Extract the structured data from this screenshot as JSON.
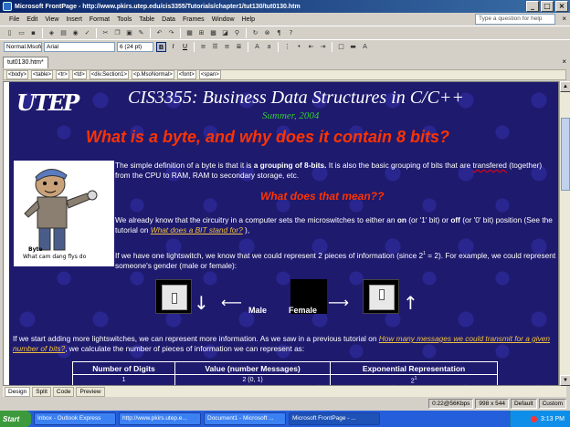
{
  "window": {
    "title": "Microsoft FrontPage - http://www.pkirs.utep.edu/cis3355/Tutorials/chapter1/tut130/tut0130.htm",
    "minimize": "_",
    "maximize": "□",
    "close": "×"
  },
  "menu": {
    "items": [
      "File",
      "Edit",
      "View",
      "Insert",
      "Format",
      "Tools",
      "Table",
      "Data",
      "Frames",
      "Window",
      "Help"
    ],
    "help_placeholder": "Type a question for help",
    "close_glyph": "×"
  },
  "format_toolbar": {
    "style": "Normal.Msofr",
    "font": "Arial",
    "size": "6 (24 pt)",
    "bold": "B",
    "italic": "I",
    "underline": "U"
  },
  "document_tab": {
    "label": "tut0130.htm*",
    "close_glyph": "×"
  },
  "tag_selector": [
    "<body>",
    "<table>",
    "<tr>",
    "<td>",
    "<div.Section1>",
    "<p.MsoNormal>",
    "<font>",
    "<span>"
  ],
  "page": {
    "logo": "UTEP",
    "course_title": "CIS3355: Business Data Structures in C/C++",
    "subtitle": "Summer, 2004",
    "heading": "What is a byte, and why does it contain 8 bits?",
    "clipart_caption_1": "Byte",
    "clipart_caption_2": "What cam dang flys do",
    "p1_a": "The simple definition of a byte is that it is ",
    "p1_bold": "a grouping of 8-bits.",
    "p1_b": " It is also the basic grouping of bits that are ",
    "p1_misspelled": "transfered",
    "p1_c": " (together) from the CPU to RAM, RAM to secondary storage, etc.",
    "question": "What does that mean??",
    "p2_a": "We already know that the circuitry in a computer sets the microswitches to either an ",
    "p2_on": "on",
    "p2_b": " (or '1' bit) or ",
    "p2_off": "off",
    "p2_c": " (or '0' bit) position (See the tutorial on ",
    "p2_link": "What does a BIT stand for?",
    "p2_d": " ),",
    "p3_a": "If we have one lightswitch, we know that we could represent 2 pieces of information (since 2",
    "p3_sup": "1",
    "p3_b": " = 2).  For example, we could represent someone's gender (male or female):",
    "label_male": "Male",
    "label_female": "Female",
    "p4_a": "If we start adding more lightswitches, we can represent more information. As we saw in a previous tutorial on ",
    "p4_link": "How many messages we could transmit for a given number of bits?",
    "p4_b": ", we calculate the number of pieces of information we can represent as:",
    "table": {
      "headers": [
        "Number of Digits",
        "Value (number Messages)",
        "Exponential Representation"
      ],
      "row1": [
        "1",
        "2 (0, 1)",
        "2"
      ],
      "row1_sup": "1"
    }
  },
  "view_tabs": [
    "Design",
    "Split",
    "Code",
    "Preview"
  ],
  "status": {
    "speed": "0:22@56Kbps",
    "size": "998 x 544",
    "mode1": "Default",
    "mode2": "Custom"
  },
  "taskbar": {
    "start": "Start",
    "items": [
      "Inbox - Outlook Express",
      "http://www.pkirs.utep.e...",
      "Document1 - Microsoft ...",
      "Microsoft FrontPage - ..."
    ],
    "clock": "3:13 PM"
  }
}
